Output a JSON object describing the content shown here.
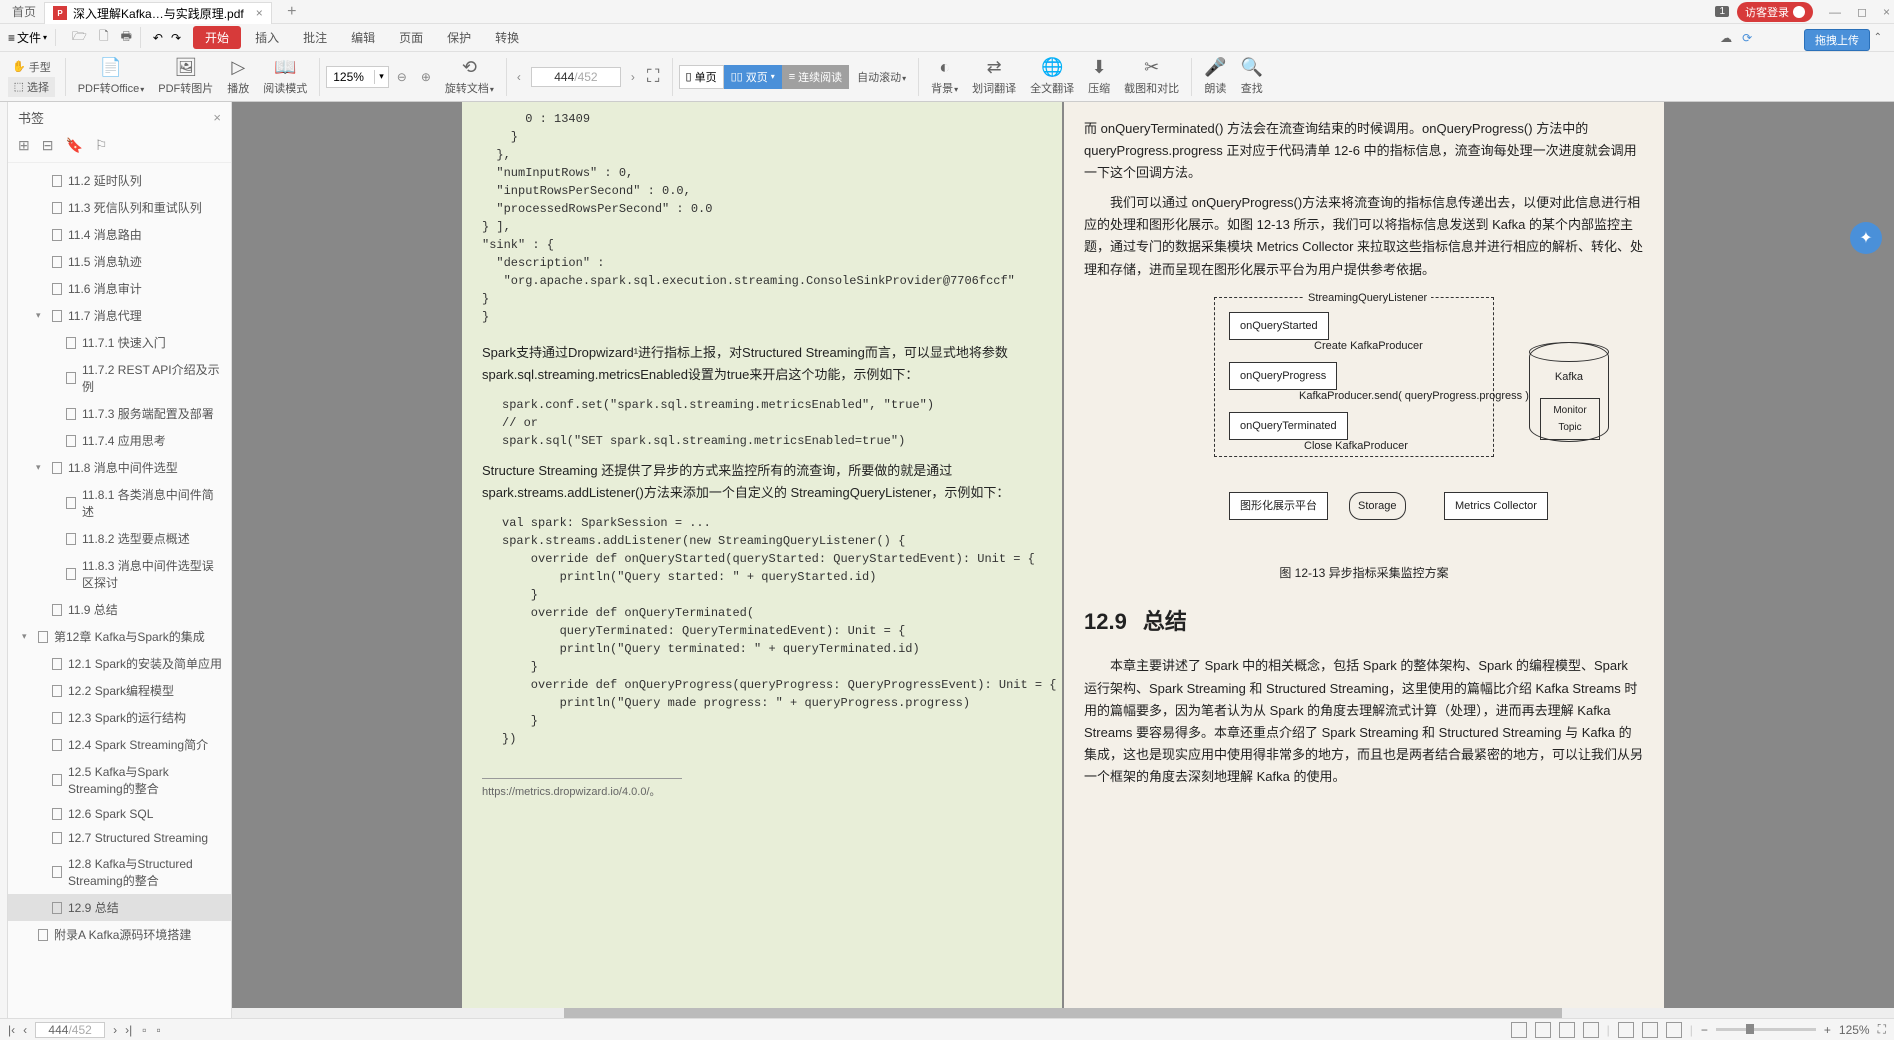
{
  "titlebar": {
    "home_tab": "首页",
    "doc_name": "深入理解Kafka…与实践原理.pdf",
    "badge": "1",
    "login": "访客登录"
  },
  "menubar": {
    "file": "文件",
    "start": "开始",
    "insert": "插入",
    "comment": "批注",
    "edit": "编辑",
    "page": "页面",
    "protect": "保护",
    "convert": "转换",
    "upload_hint": "拖拽上传"
  },
  "toolbar": {
    "hand": "手型",
    "select": "选择",
    "pdf_office": "PDF转Office",
    "pdf_image": "PDF转图片",
    "play": "播放",
    "read_mode": "阅读模式",
    "zoom_val": "125%",
    "rotate": "旋转文档",
    "page_cur": "444",
    "page_total": "/452",
    "single_page": "单页",
    "double_page": "双页",
    "continuous": "连续阅读",
    "auto_scroll": "自动滚动",
    "background": "背景",
    "word_trans": "划词翻译",
    "full_trans": "全文翻译",
    "compress": "压缩",
    "crop_compare": "截图和对比",
    "read_aloud": "朗读",
    "find": "查找"
  },
  "sidebar": {
    "title": "书签",
    "items": [
      {
        "label": "11.2 延时队列",
        "level": 1
      },
      {
        "label": "11.3 死信队列和重试队列",
        "level": 1
      },
      {
        "label": "11.4 消息路由",
        "level": 1
      },
      {
        "label": "11.5 消息轨迹",
        "level": 1
      },
      {
        "label": "11.6 消息审计",
        "level": 1
      },
      {
        "label": "11.7 消息代理",
        "level": 1,
        "expanded": true
      },
      {
        "label": "11.7.1 快速入门",
        "level": 2
      },
      {
        "label": "11.7.2 REST API介绍及示例",
        "level": 2
      },
      {
        "label": "11.7.3 服务端配置及部署",
        "level": 2
      },
      {
        "label": "11.7.4 应用思考",
        "level": 2
      },
      {
        "label": "11.8 消息中间件选型",
        "level": 1,
        "expanded": true
      },
      {
        "label": "11.8.1 各类消息中间件简述",
        "level": 2
      },
      {
        "label": "11.8.2 选型要点概述",
        "level": 2
      },
      {
        "label": "11.8.3 消息中间件选型误区探讨",
        "level": 2
      },
      {
        "label": "11.9 总结",
        "level": 1
      },
      {
        "label": "第12章 Kafka与Spark的集成",
        "level": 0,
        "expanded": true
      },
      {
        "label": "12.1 Spark的安装及简单应用",
        "level": 1
      },
      {
        "label": "12.2 Spark编程模型",
        "level": 1
      },
      {
        "label": "12.3 Spark的运行结构",
        "level": 1
      },
      {
        "label": "12.4 Spark Streaming简介",
        "level": 1
      },
      {
        "label": "12.5 Kafka与Spark Streaming的整合",
        "level": 1
      },
      {
        "label": "12.6 Spark SQL",
        "level": 1
      },
      {
        "label": "12.7 Structured Streaming",
        "level": 1
      },
      {
        "label": "12.8 Kafka与Structured Streaming的整合",
        "level": 1
      },
      {
        "label": "12.9 总结",
        "level": 1,
        "active": true
      },
      {
        "label": "附录A Kafka源码环境搭建",
        "level": 0
      }
    ]
  },
  "page_left": {
    "code1": "      0 : 13409\n    }\n  },\n  \"numInputRows\" : 0,\n  \"inputRowsPerSecond\" : 0.0,\n  \"processedRowsPerSecond\" : 0.0\n} ],\n\"sink\" : {\n  \"description\" :\n   \"org.apache.spark.sql.execution.streaming.ConsoleSinkProvider@7706fccf\"\n}\n}",
    "para1": "Spark支持通过Dropwizard¹进行指标上报，对Structured Streaming而言，可以显式地将参数spark.sql.streaming.metricsEnabled设置为true来开启这个功能，示例如下：",
    "code2": "spark.conf.set(\"spark.sql.streaming.metricsEnabled\", \"true\")\n// or\nspark.sql(\"SET spark.sql.streaming.metricsEnabled=true\")",
    "para2": "Structure Streaming 还提供了异步的方式来监控所有的流查询，所要做的就是通过spark.streams.addListener()方法来添加一个自定义的 StreamingQueryListener，示例如下：",
    "code3": "val spark: SparkSession = ...\nspark.streams.addListener(new StreamingQueryListener() {\n    override def onQueryStarted(queryStarted: QueryStartedEvent): Unit = {\n        println(\"Query started: \" + queryStarted.id)\n    }\n    override def onQueryTerminated(\n        queryTerminated: QueryTerminatedEvent): Unit = {\n        println(\"Query terminated: \" + queryTerminated.id)\n    }\n    override def onQueryProgress(queryProgress: QueryProgressEvent): Unit = {\n        println(\"Query made progress: \" + queryProgress.progress)\n    }\n})",
    "footnote": "https://metrics.dropwizard.io/4.0.0/。"
  },
  "page_right": {
    "para1": "而 onQueryTerminated() 方法会在流查询结束的时候调用。onQueryProgress() 方法中的queryProgress.progress 正对应于代码清单 12-6 中的指标信息，流查询每处理一次进度就会调用一下这个回调方法。",
    "para2": "我们可以通过 onQueryProgress()方法来将流查询的指标信息传递出去，以便对此信息进行相应的处理和图形化展示。如图 12-13 所示，我们可以将指标信息发送到 Kafka 的某个内部监控主题，通过专门的数据采集模块 Metrics Collector 来拉取这些指标信息并进行相应的解析、转化、处理和存储，进而呈现在图形化展示平台为用户提供参考依据。",
    "diagram": {
      "listener": "StreamingQueryListener",
      "box1": "onQueryStarted",
      "label1": "Create KafkaProducer",
      "box2": "onQueryProgress",
      "label2": "KafkaProducer.send( queryProgress.progress )",
      "box3": "onQueryTerminated",
      "label3": "Close KafkaProducer",
      "kafka": "Kafka",
      "monitor": "Monitor\nTopic",
      "platform": "图形化展示平台",
      "storage": "Storage",
      "collector": "Metrics Collector",
      "caption": "图 12-13 异步指标采集监控方案"
    },
    "sec_num": "12.9",
    "sec_title": "总结",
    "para3": "本章主要讲述了 Spark 中的相关概念，包括 Spark 的整体架构、Spark 的编程模型、Spark 运行架构、Spark Streaming 和 Structured Streaming，这里使用的篇幅比介绍 Kafka Streams 时用的篇幅要多，因为笔者认为从 Spark 的角度去理解流式计算（处理），进而再去理解 Kafka Streams 要容易得多。本章还重点介绍了 Spark Streaming 和 Structured Streaming 与 Kafka 的集成，这也是现实应用中使用得非常多的地方，而且也是两者结合最紧密的地方，可以让我们从另一个框架的角度去深刻地理解 Kafka 的使用。"
  },
  "statusbar": {
    "page_cur": "444",
    "page_total": "/452",
    "zoom": "125%"
  }
}
